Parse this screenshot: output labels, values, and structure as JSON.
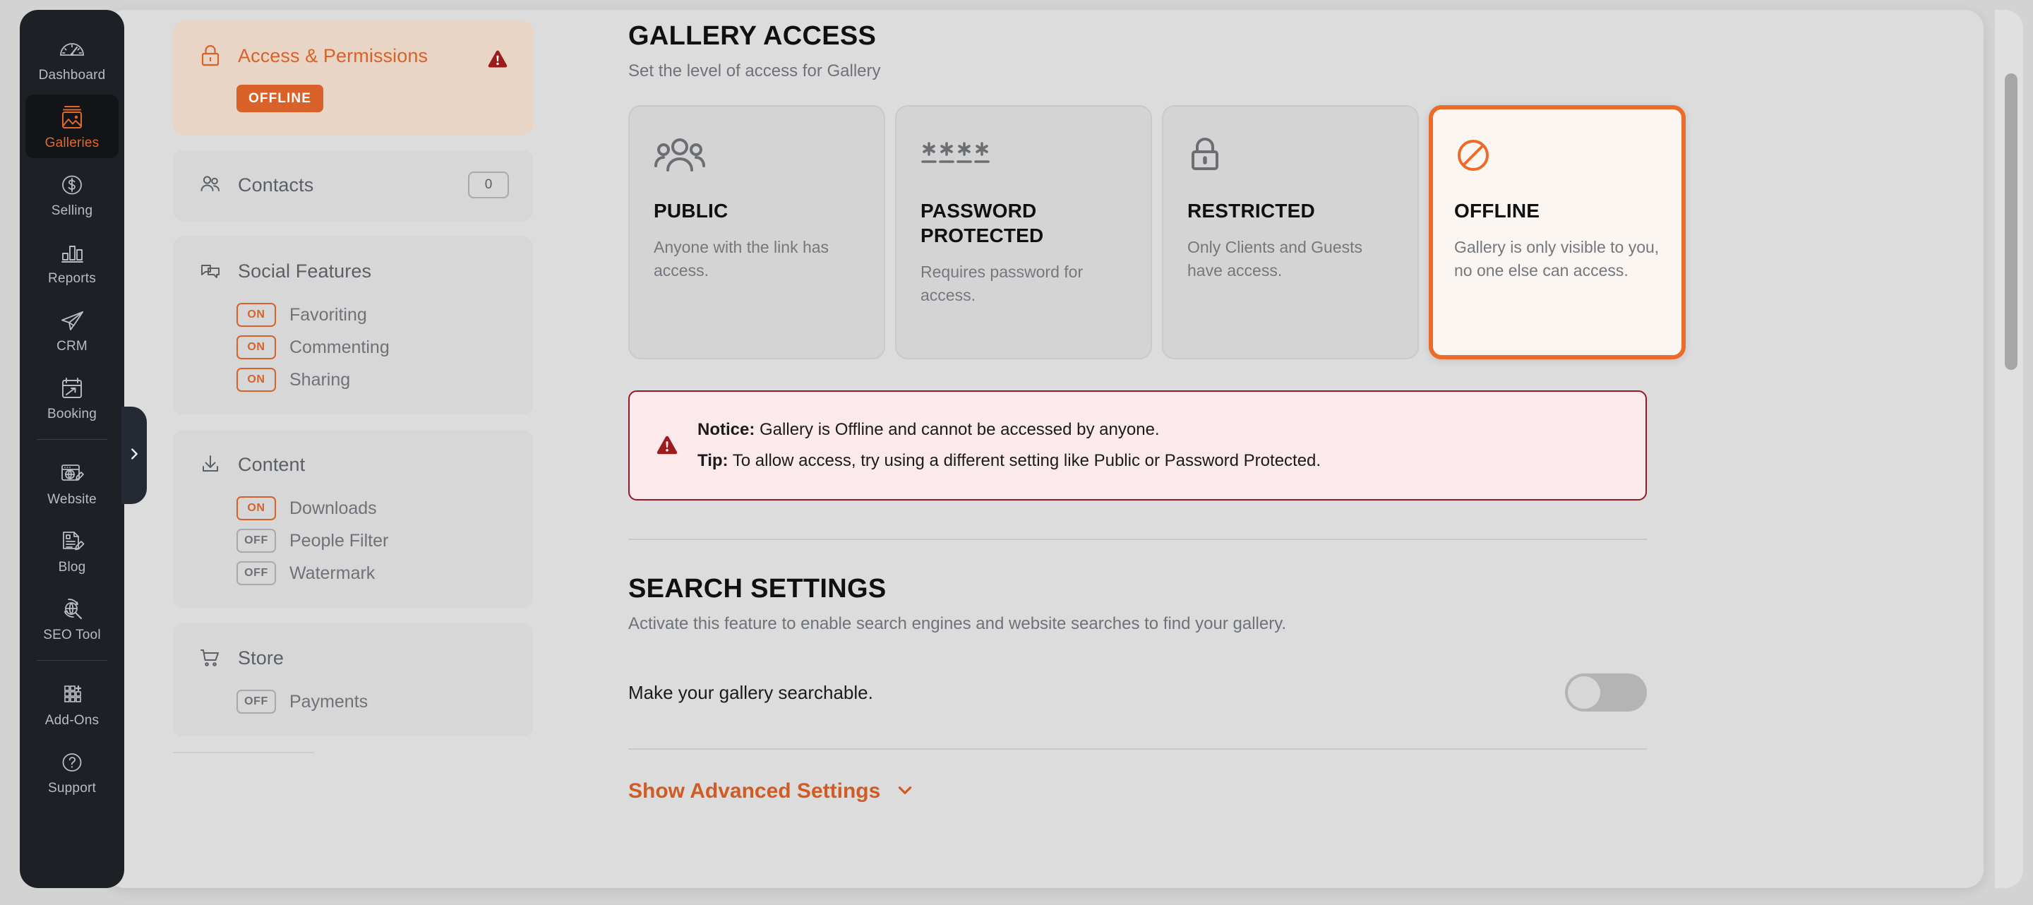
{
  "rail": {
    "items": [
      {
        "label": "Dashboard",
        "icon": "gauge-icon",
        "active": false
      },
      {
        "label": "Galleries",
        "icon": "image-stack-icon",
        "active": true
      },
      {
        "label": "Selling",
        "icon": "dollar-circle-icon",
        "active": false
      },
      {
        "label": "Reports",
        "icon": "bar-chart-icon",
        "active": false
      },
      {
        "label": "CRM",
        "icon": "paper-plane-icon",
        "active": false
      },
      {
        "label": "Booking",
        "icon": "calendar-arrow-icon",
        "active": false
      },
      {
        "label": "Website",
        "icon": "browser-pencil-icon",
        "active": false
      },
      {
        "label": "Blog",
        "icon": "document-pencil-icon",
        "active": false
      },
      {
        "label": "SEO Tool",
        "icon": "globe-search-icon",
        "active": false
      },
      {
        "label": "Add-Ons",
        "icon": "grid-plus-icon",
        "active": false
      },
      {
        "label": "Support",
        "icon": "question-circle-icon",
        "active": false
      }
    ],
    "collapse_icon": "chevron-right-icon"
  },
  "settings_panel": {
    "access": {
      "title": "Access & Permissions",
      "icon": "lock-icon",
      "warning_icon": "warning-triangle-icon",
      "badge": "OFFLINE"
    },
    "contacts": {
      "title": "Contacts",
      "icon": "people-icon",
      "count": "0"
    },
    "social": {
      "title": "Social Features",
      "icon": "chat-bubbles-icon",
      "rows": [
        {
          "state": "ON",
          "label": "Favoriting"
        },
        {
          "state": "ON",
          "label": "Commenting"
        },
        {
          "state": "ON",
          "label": "Sharing"
        }
      ]
    },
    "content": {
      "title": "Content",
      "icon": "download-icon",
      "rows": [
        {
          "state": "ON",
          "label": "Downloads"
        },
        {
          "state": "OFF",
          "label": "People Filter"
        },
        {
          "state": "OFF",
          "label": "Watermark"
        }
      ]
    },
    "store": {
      "title": "Store",
      "icon": "cart-icon",
      "rows": [
        {
          "state": "OFF",
          "label": "Payments"
        }
      ]
    }
  },
  "main": {
    "gallery_access": {
      "title": "GALLERY ACCESS",
      "subtitle": "Set the level of access for Gallery",
      "options": [
        {
          "id": "public",
          "icon": "group-people-icon",
          "title": "PUBLIC",
          "description": "Anyone with the link has access.",
          "selected": false
        },
        {
          "id": "password-protected",
          "icon": "asterisks-icon",
          "title": "PASSWORD PROTECTED",
          "description": "Requires password for access.",
          "selected": false
        },
        {
          "id": "restricted",
          "icon": "padlock-icon",
          "title": "RESTRICTED",
          "description": "Only Clients and Guests have access.",
          "selected": false
        },
        {
          "id": "offline",
          "icon": "no-entry-icon",
          "title": "OFFLINE",
          "description": "Gallery is only visible to you, no one else can access.",
          "selected": true
        }
      ]
    },
    "notice": {
      "icon": "warning-triangle-icon",
      "notice_label": "Notice:",
      "notice_text": " Gallery is Offline and cannot be accessed by anyone.",
      "tip_label": "Tip:",
      "tip_text": " To allow access, try using a different setting like Public or Password Protected."
    },
    "search_settings": {
      "title": "SEARCH SETTINGS",
      "subtitle": "Activate this feature to enable search engines and website searches to find your gallery.",
      "toggle_label": "Make your gallery searchable.",
      "toggle_state": "off"
    },
    "advanced": {
      "label": "Show Advanced Settings",
      "icon": "chevron-down-icon"
    }
  },
  "colors": {
    "accent_orange": "#e2682a",
    "selected_border": "#ec6b28",
    "notice_border": "#8e1d1f",
    "notice_bg": "#fbe9eb",
    "rail_bg": "#1d2025",
    "page_bg": "#d3d3d4"
  }
}
